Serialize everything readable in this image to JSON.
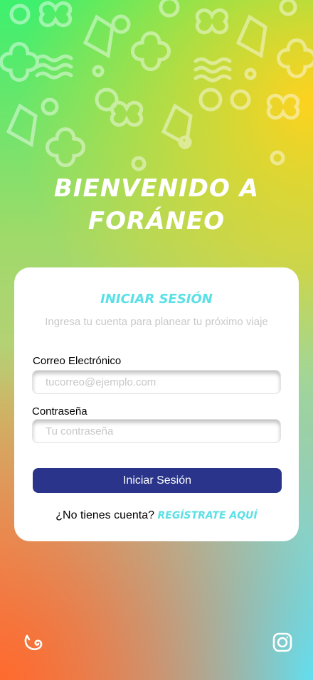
{
  "hero": {
    "title_line1": "BIENVENIDO A",
    "title_line2": "FORÁNEO"
  },
  "login_card": {
    "title": "INICIAR SESIÓN",
    "subtitle": "Ingresa tu cuenta para planear tu próximo viaje",
    "email": {
      "label": "Correo Electrónico",
      "placeholder": "tucorreo@ejemplo.com",
      "value": ""
    },
    "password": {
      "label": "Contraseña",
      "placeholder": "Tu contraseña",
      "value": ""
    },
    "submit_label": "Iniciar Sesión",
    "register_prompt": "¿No tienes cuenta?",
    "register_link": "REGÍSTRATE AQUÍ"
  },
  "footer": {
    "left_icon": "snail-icon",
    "right_icon": "instagram-icon"
  },
  "colors": {
    "accent_cyan": "#5ae0e6",
    "button_navy": "#29348a",
    "card_bg": "#ffffff"
  }
}
